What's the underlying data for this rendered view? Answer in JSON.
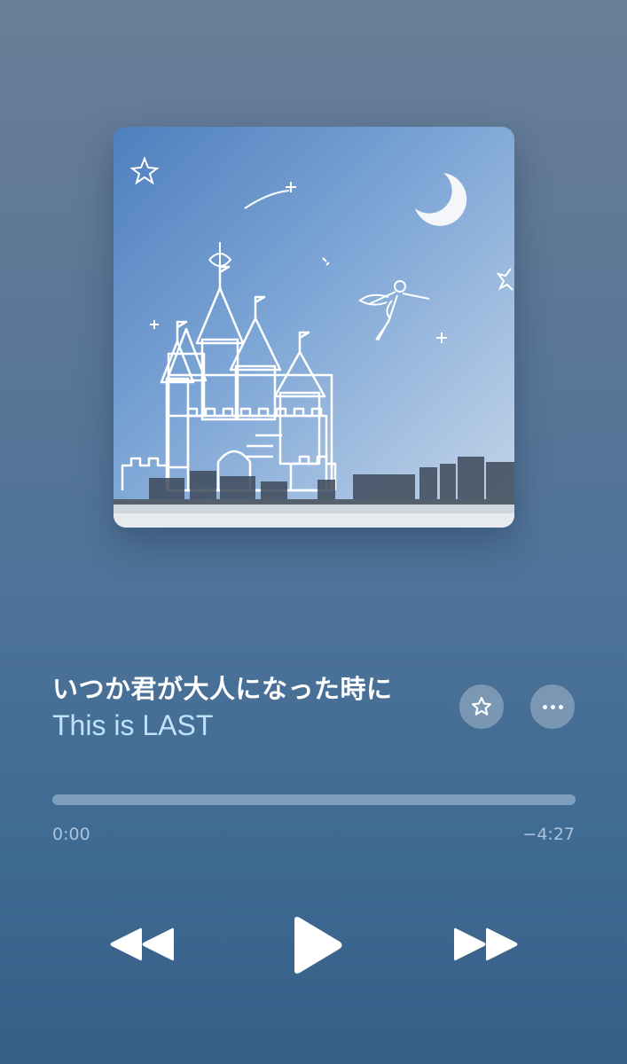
{
  "track": {
    "title": "いつか君が大人になった時に",
    "artist": "This is LAST"
  },
  "actions": {
    "favorite_icon": "star-icon",
    "more_icon": "ellipsis-icon"
  },
  "playback": {
    "progress": 0.0,
    "elapsed": "0:00",
    "remaining": "−4:27"
  },
  "controls": {
    "rewind_icon": "rewind-icon",
    "play_icon": "play-icon",
    "forward_icon": "fast-forward-icon"
  },
  "colors": {
    "artist_text": "#bfe2fb",
    "accent_white": "#ffffff"
  }
}
